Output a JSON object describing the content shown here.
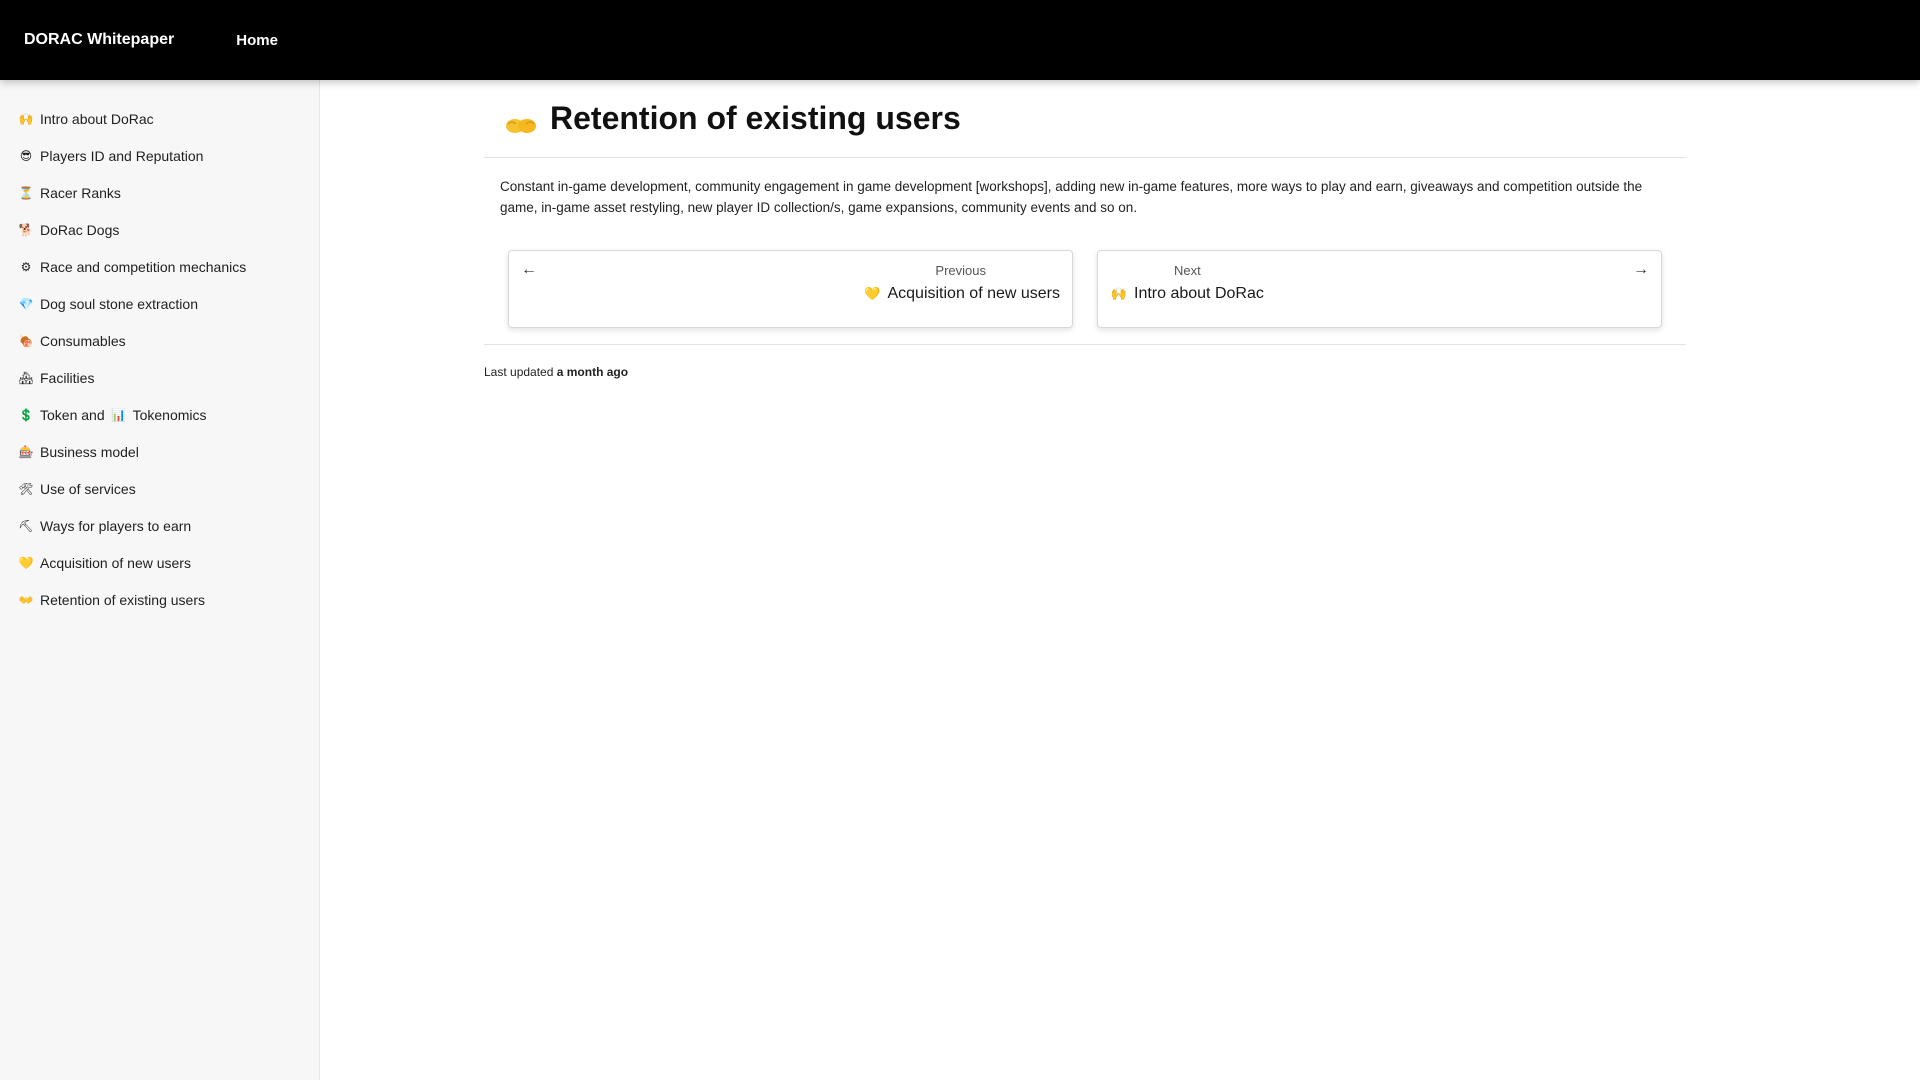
{
  "header": {
    "brand": "DORAC Whitepaper",
    "nav_home": "Home"
  },
  "sidebar": {
    "items": [
      {
        "icon": "raised-hands-icon",
        "emoji": "🙌",
        "label": "Intro about DoRac"
      },
      {
        "icon": "sunglasses-face-icon",
        "emoji": "😎",
        "label": "Players ID and Reputation"
      },
      {
        "icon": "hourglass-icon",
        "emoji": "⏳",
        "label": "Racer Ranks"
      },
      {
        "icon": "dog-icon",
        "emoji": "🐕",
        "label": "DoRac Dogs"
      },
      {
        "icon": "gear-icon",
        "emoji": "⚙",
        "label": "Race and competition mechanics"
      },
      {
        "icon": "gem-icon",
        "emoji": "💎",
        "label": "Dog soul stone extraction"
      },
      {
        "icon": "meat-icon",
        "emoji": "🍖",
        "label": "Consumables"
      },
      {
        "icon": "houses-icon",
        "emoji": "🏘",
        "label": "Facilities"
      },
      {
        "icon": "dollar-icon",
        "emoji": "💲",
        "label": "Token and",
        "emoji2": "📊",
        "label2": "Tokenomics"
      },
      {
        "icon": "slot-machine-icon",
        "emoji": "🎰",
        "label": "Business model"
      },
      {
        "icon": "tools-icon",
        "emoji": "🛠",
        "label": "Use of services"
      },
      {
        "icon": "pick-icon",
        "emoji": "⛏",
        "label": "Ways for players to earn"
      },
      {
        "icon": "heart-icon",
        "emoji": "💛",
        "label": "Acquisition of new users"
      },
      {
        "icon": "open-hands-icon",
        "emoji": "👐",
        "label": "Retention of existing users"
      }
    ]
  },
  "main": {
    "title_emoji": "👐",
    "title": "Retention of existing users",
    "body": "Constant in-game development, community engagement in game development [workshops], adding new in-game features, more ways to play and earn, giveaways and competition outside the game, in-game asset restyling, new player ID collection/s, game expansions, community events and so on.",
    "pager": {
      "prev_caption": "Previous",
      "prev_emoji": "💛",
      "prev_title": "Acquisition of new users",
      "next_caption": "Next",
      "next_emoji": "🙌",
      "next_title": "Intro about DoRac"
    },
    "updated_prefix": "Last updated",
    "updated_value": "a month ago"
  },
  "colors": {
    "topbar": "#000000",
    "sidebar_bg": "#f7f7f8",
    "accent_yellow": "#f4c430"
  }
}
